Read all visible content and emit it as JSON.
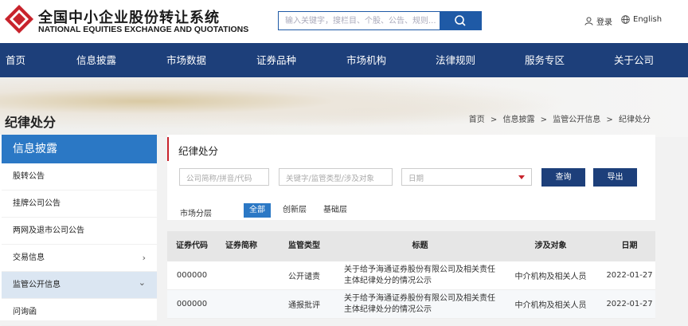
{
  "header": {
    "logo_cn": "全国中小企业股份转让系统",
    "logo_en": "NATIONAL EQUITIES EXCHANGE AND QUOTATIONS",
    "search_placeholder": "输入关键字，搜栏目、个股、公告、规则...",
    "login_label": "登录",
    "language_label": "English"
  },
  "nav": {
    "items": [
      "首页",
      "信息披露",
      "市场数据",
      "证券品种",
      "市场机构",
      "法律规则",
      "服务专区",
      "关于公司"
    ]
  },
  "page": {
    "title": "纪律处分",
    "breadcrumb": [
      "首页",
      "信息披露",
      "监管公开信息",
      "纪律处分"
    ],
    "breadcrumb_sep": ">"
  },
  "sidebar": {
    "heading": "信息披露",
    "items": [
      {
        "label": "股转公告",
        "chevron": ""
      },
      {
        "label": "挂牌公司公告",
        "chevron": ""
      },
      {
        "label": "两网及退市公司公告",
        "chevron": ""
      },
      {
        "label": "交易信息",
        "chevron": "›"
      },
      {
        "label": "监管公开信息",
        "chevron": "⌄"
      },
      {
        "label": "问询函",
        "chevron": ""
      }
    ]
  },
  "panel": {
    "title": "纪律处分",
    "company_placeholder": "公司简称/拼音/代码",
    "keyword_placeholder": "关键字/监管类型/涉及对象",
    "date_placeholder": "日期",
    "query_label": "查询",
    "export_label": "导出",
    "layer_label": "市场分层",
    "tabs": [
      "全部",
      "创新层",
      "基础层"
    ]
  },
  "table": {
    "headers": [
      "证券代码",
      "证券简称",
      "监管类型",
      "标题",
      "涉及对象",
      "日期"
    ],
    "rows": [
      {
        "code": "000000",
        "name": "",
        "type": "公开谴责",
        "title": "关于给予海通证券股份有限公司及相关责任主体纪律处分的情况公示",
        "object": "中介机构及相关人员",
        "date": "2022-01-27"
      },
      {
        "code": "000000",
        "name": "",
        "type": "通报批评",
        "title": "关于给予海通证券股份有限公司及相关责任主体纪律处分的情况公示",
        "object": "中介机构及相关人员",
        "date": "2022-01-27"
      }
    ]
  },
  "colors": {
    "nav_bg": "#1d3f7a",
    "accent_blue": "#2b78c5",
    "logo_red": "#c8232c"
  }
}
